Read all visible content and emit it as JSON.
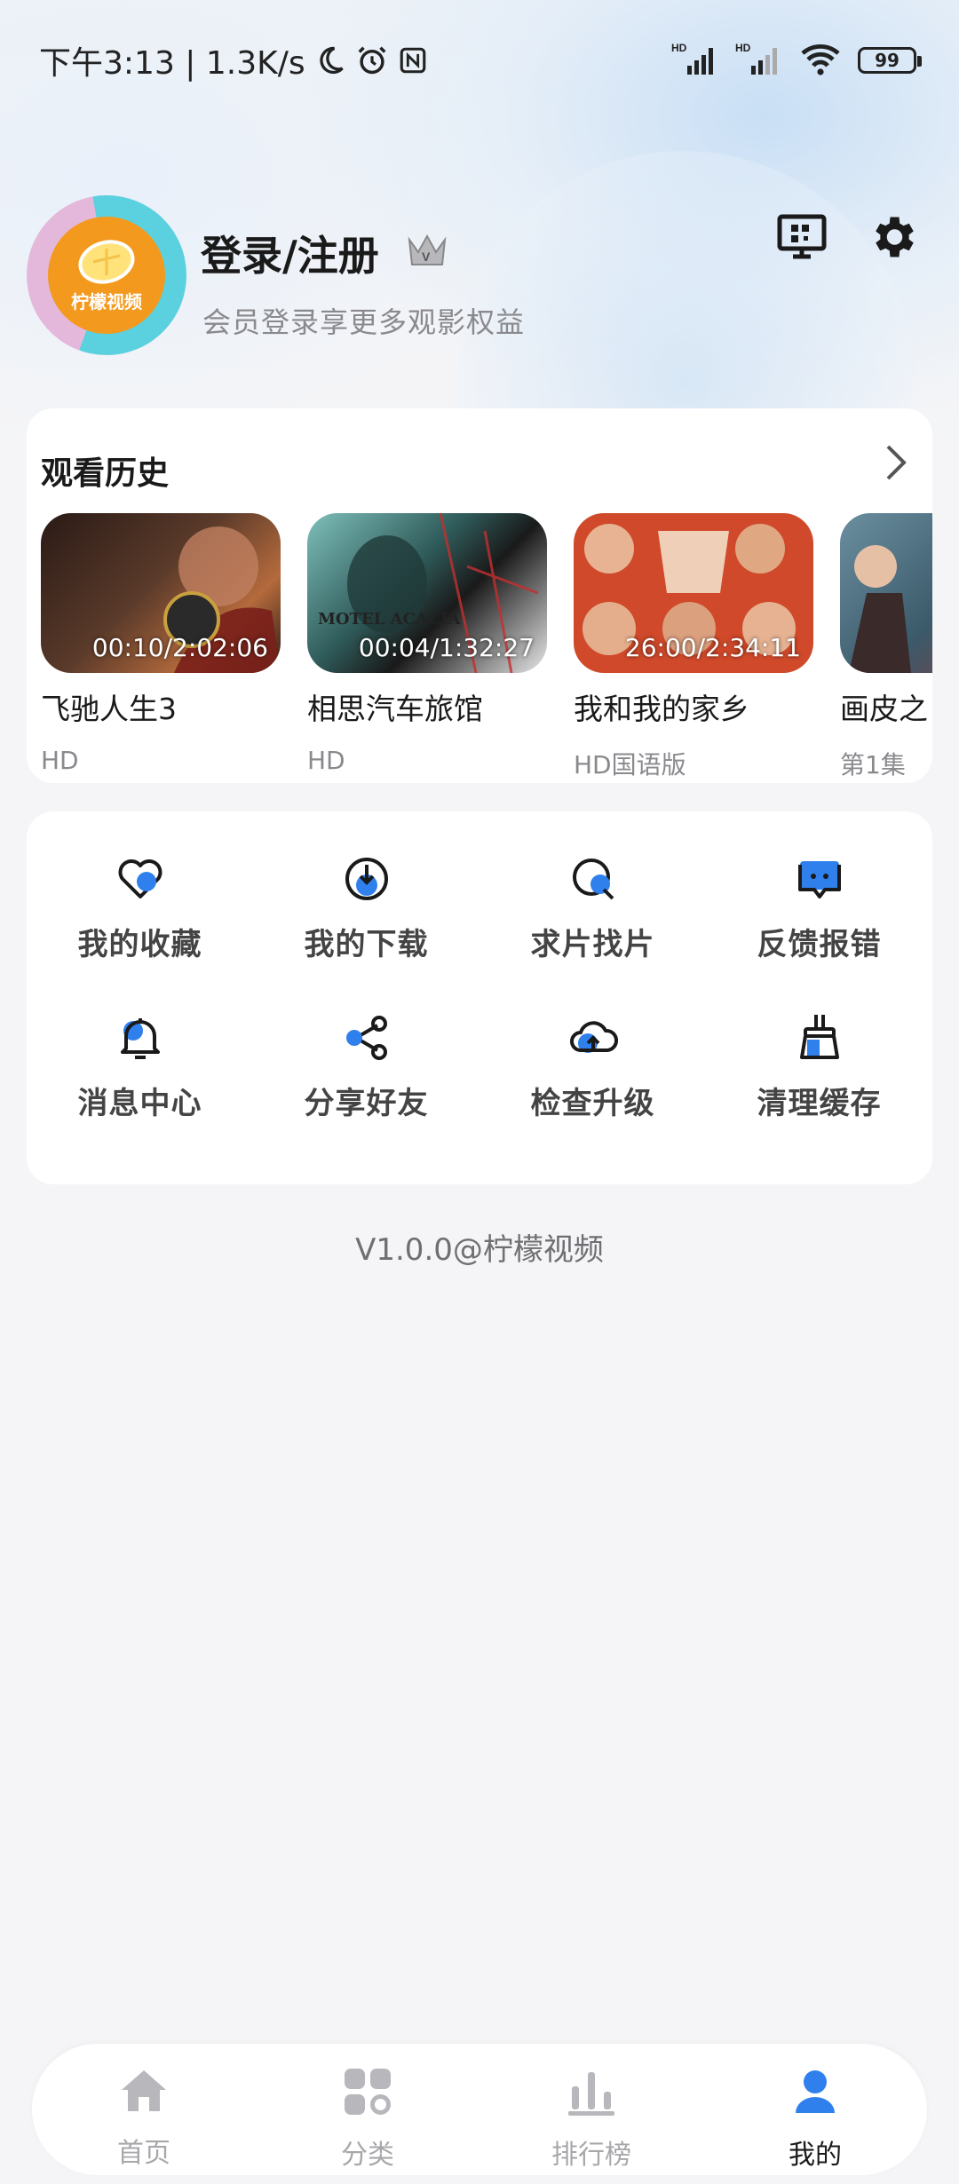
{
  "status_bar": {
    "time_speed": "下午3:13 | 1.3K/s",
    "network_1": "HD",
    "network_2": "HD",
    "battery": "99"
  },
  "profile": {
    "avatar_text": "柠檬视频",
    "title": "登录/注册",
    "subtitle": "会员登录享更多观影权益",
    "crown_icon": "crown-icon",
    "screen_icon": "screen-cast-icon",
    "settings_icon": "gear-icon"
  },
  "history": {
    "title": "观看历史",
    "items": [
      {
        "name": "飞驰人生3",
        "sub": "HD",
        "time": "00:10/2:02:06",
        "color": "#5a3a2a"
      },
      {
        "name": "相思汽车旅馆",
        "sub": "HD",
        "time": "00:04/1:32:27",
        "color": "#2f5b5a"
      },
      {
        "name": "我和我的家乡",
        "sub": "HD国语版",
        "time": "26:00/2:34:11",
        "color": "#d0492a"
      },
      {
        "name": "画皮之",
        "sub": "第1集",
        "time": "0",
        "color": "#3b5a6a"
      }
    ]
  },
  "menu": {
    "items": [
      {
        "label": "我的收藏",
        "icon": "heart-icon"
      },
      {
        "label": "我的下载",
        "icon": "download-icon"
      },
      {
        "label": "求片找片",
        "icon": "search-icon"
      },
      {
        "label": "反馈报错",
        "icon": "feedback-icon"
      },
      {
        "label": "消息中心",
        "icon": "bell-icon"
      },
      {
        "label": "分享好友",
        "icon": "share-icon"
      },
      {
        "label": "检查升级",
        "icon": "cloud-upload-icon"
      },
      {
        "label": "清理缓存",
        "icon": "broom-icon"
      }
    ],
    "accent": "#2f80ed"
  },
  "version": "V1.0.0@柠檬视频",
  "nav": {
    "items": [
      {
        "label": "首页",
        "icon": "home-icon"
      },
      {
        "label": "分类",
        "icon": "category-icon"
      },
      {
        "label": "排行榜",
        "icon": "chart-icon"
      },
      {
        "label": "我的",
        "icon": "user-icon"
      }
    ],
    "active": "我的"
  }
}
